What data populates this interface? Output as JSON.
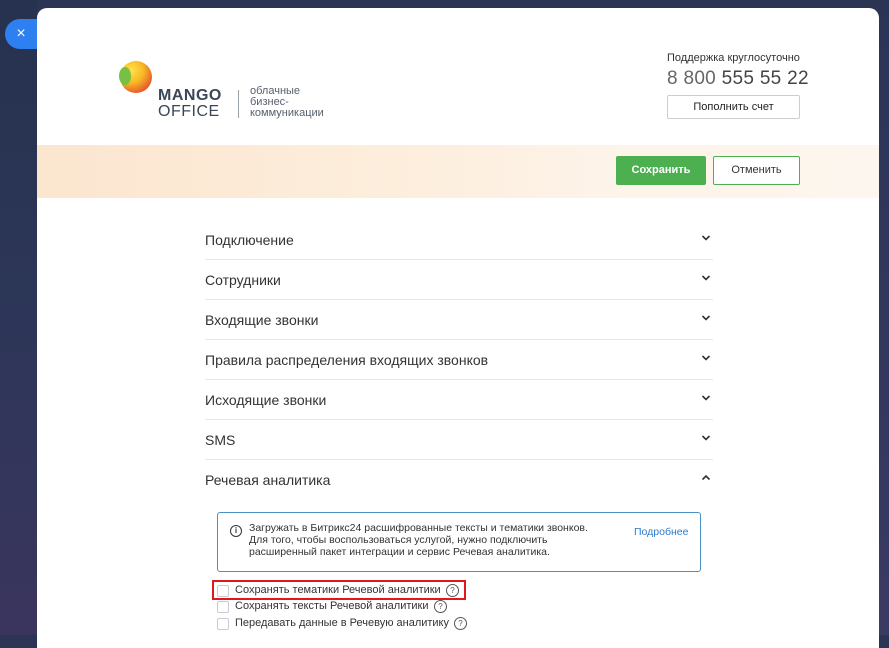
{
  "close": {
    "icon": "×"
  },
  "header": {
    "brand_line1": "MANGO",
    "brand_line2": "OFFICE",
    "tagline_line1": "облачные",
    "tagline_line2": "бизнес-",
    "tagline_line3": "коммуникации",
    "support_label": "Поддержка круглосуточно",
    "phone_prefix": "8 800",
    "phone_rest": "555 55 22",
    "topup_label": "Пополнить счет"
  },
  "actions": {
    "save_label": "Сохранить",
    "cancel_label": "Отменить"
  },
  "accordion": {
    "items": [
      {
        "label": "Подключение",
        "state": "collapsed"
      },
      {
        "label": "Сотрудники",
        "state": "collapsed"
      },
      {
        "label": "Входящие звонки",
        "state": "collapsed"
      },
      {
        "label": "Правила распределения входящих звонков",
        "state": "collapsed"
      },
      {
        "label": "Исходящие звонки",
        "state": "collapsed"
      },
      {
        "label": "SMS",
        "state": "collapsed"
      },
      {
        "label": "Речевая аналитика",
        "state": "expanded"
      }
    ]
  },
  "speech": {
    "info_line1": "Загружать в Битрикс24 расшифрованные тексты и тематики звонков.",
    "info_line2": "Для того, чтобы воспользоваться услугой, нужно подключить",
    "info_line3": "расширенный пакет интеграции и сервис Речевая аналитика.",
    "info_link": "Подробнее",
    "options": [
      {
        "label": "Сохранять тематики Речевой аналитики",
        "checked": false,
        "highlighted": true
      },
      {
        "label": "Сохранять тексты Речевой аналитики",
        "checked": false
      },
      {
        "label": "Передавать данные в Речевую аналитику",
        "checked": false
      }
    ],
    "help_icon": "?"
  },
  "colors": {
    "accent_green": "#4caf50",
    "link_blue": "#2b7bcf",
    "highlight_red": "#e0181e",
    "close_blue": "#2e7ff0"
  }
}
